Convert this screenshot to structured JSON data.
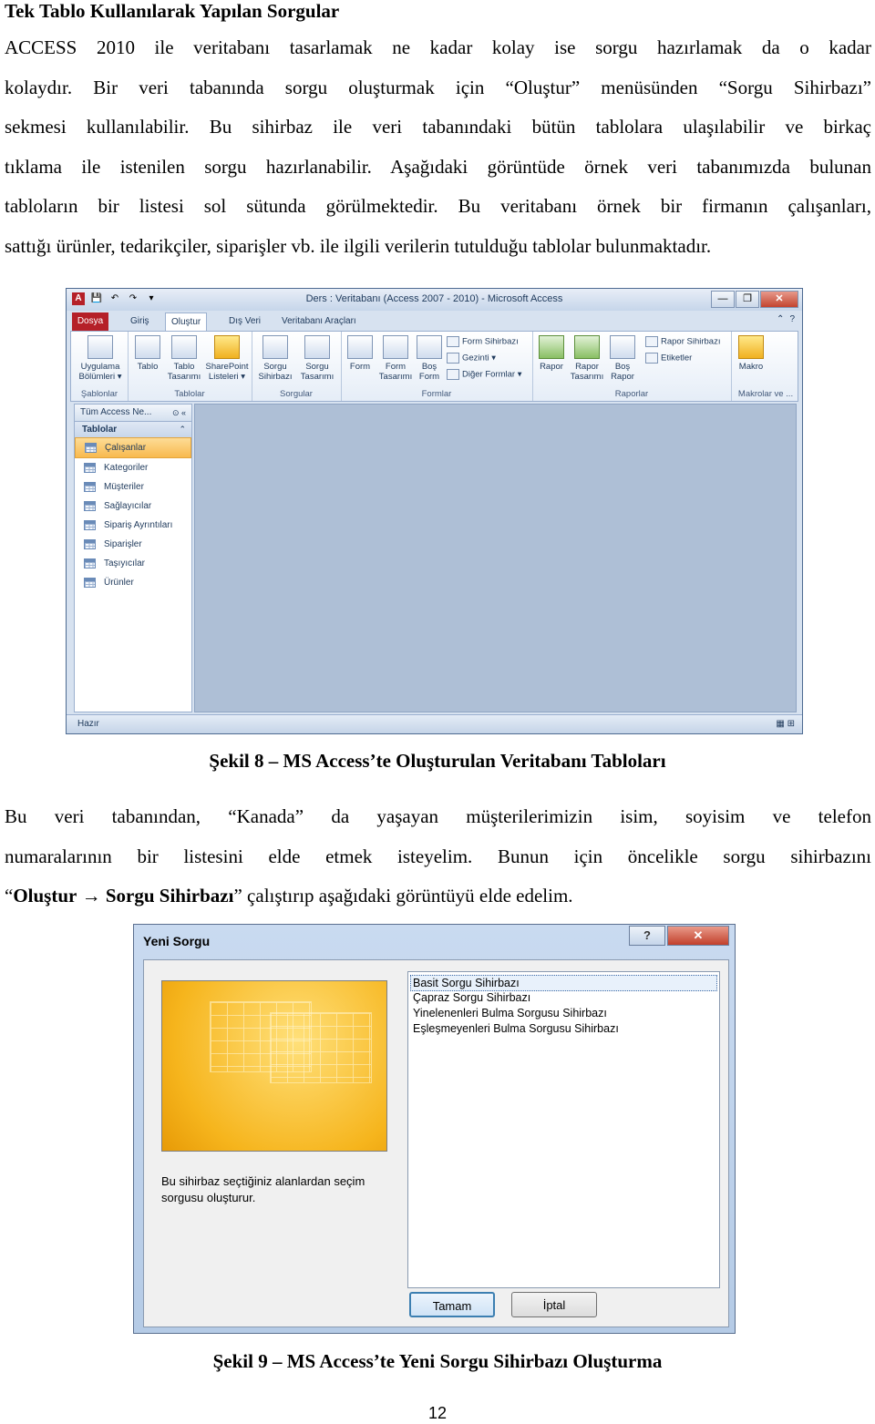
{
  "heading": "Tek Tablo Kullanılarak Yapılan Sorgular",
  "para1_lines": [
    "ACCESS 2010 ile veritabanı tasarlamak ne kadar kolay ise sorgu hazırlamak da o kadar",
    "kolaydır. Bir veri tabanında sorgu oluşturmak için “Oluştur” menüsünden “Sorgu Sihirbazı”",
    "sekmesi kullanılabilir. Bu sihirbaz ile veri tabanındaki bütün tablolara ulaşılabilir ve birkaç",
    "tıklama ile istenilen sorgu hazırlanabilir. Aşağıdaki görüntüde örnek veri tabanımızda bulunan",
    "tabloların bir listesi sol sütunda görülmektedir. Bu veritabanı örnek bir firmanın çalışanları,",
    "sattığı ürünler, tedarikçiler, siparişler vb. ile ilgili verilerin tutulduğu tablolar bulunmaktadır."
  ],
  "figure8": {
    "window_title": "Ders : Veritabanı (Access 2007 - 2010) - Microsoft Access",
    "qat": [
      "A",
      "💾",
      "↶",
      "↷",
      "▾"
    ],
    "window_buttons": [
      "—",
      "❐",
      "✕"
    ],
    "help_glyphs": [
      "⌃",
      "?"
    ],
    "tabs": [
      "Dosya",
      "Giriş",
      "Oluştur",
      "Dış Veri",
      "Veritabanı Araçları"
    ],
    "active_tab": "Oluştur",
    "ribbon": {
      "sablonlar": {
        "label": "Şablonlar",
        "buttons": [
          "Uygulama\nBölümleri ▾"
        ]
      },
      "tablolar": {
        "label": "Tablolar",
        "buttons": [
          "Tablo",
          "Tablo\nTasarımı",
          "SharePoint\nListeleri ▾"
        ]
      },
      "sorgular": {
        "label": "Sorgular",
        "buttons": [
          "Sorgu\nSihirbazı",
          "Sorgu\nTasarımı"
        ]
      },
      "formlar": {
        "label": "Formlar",
        "buttons": [
          "Form",
          "Form\nTasarımı",
          "Boş\nForm"
        ],
        "small": [
          "Form Sihirbazı",
          "Gezinti ▾",
          "Diğer Formlar ▾"
        ]
      },
      "raporlar": {
        "label": "Raporlar",
        "buttons": [
          "Rapor",
          "Rapor\nTasarımı",
          "Boş\nRapor"
        ],
        "small": [
          "Rapor Sihirbazı",
          "Etiketler"
        ]
      },
      "makrolar": {
        "label": "Makrolar ve ...",
        "buttons": [
          "Makro"
        ]
      }
    },
    "nav_header": "Tüm Access Ne...",
    "nav_header_ctrls": "⊙ «",
    "nav_section": "Tablolar",
    "nav_section_ctrls": "⌃",
    "nav_items": [
      "Çalışanlar",
      "Kategoriler",
      "Müşteriler",
      "Sağlayıcılar",
      "Sipariş Ayrıntıları",
      "Siparişler",
      "Taşıyıcılar",
      "Ürünler"
    ],
    "status": "Hazır",
    "status_views": "▦ ⊞"
  },
  "caption8": "Şekil 8 – MS Access’te Oluşturulan Veritabanı Tabloları",
  "para2_lines": [
    "Bu veri tabanından, “Kanada” da yaşayan müşterilerimizin isim, soyisim ve telefon",
    "numaralarının bir listesini elde etmek isteyelim. Bunun için öncelikle sorgu sihirbazını"
  ],
  "para2_last": {
    "open_quote": "“",
    "olustur": "Oluştur",
    "arrow": "→",
    "sihirbaz": "Sorgu Sihirbazı",
    "close_quote": "”",
    "rest": " çalıştırıp aşağıdaki görüntüyü elde edelim."
  },
  "figure9": {
    "title": "Yeni Sorgu",
    "help_glyph": "?",
    "close_glyph": "✕",
    "description": "Bu sihirbaz seçtiğiniz alanlardan seçim sorgusu oluşturur.",
    "options": [
      "Basit Sorgu Sihirbazı",
      "Çapraz Sorgu Sihirbazı",
      "Yinelenenleri Bulma Sorgusu Sihirbazı",
      "Eşleşmeyenleri Bulma Sorgusu Sihirbazı"
    ],
    "selected_option": "Basit Sorgu Sihirbazı",
    "ok_label": "Tamam",
    "cancel_label": "İptal"
  },
  "caption9": "Şekil 9 – MS Access’te Yeni Sorgu Sihirbazı Oluşturma",
  "page_number": "12"
}
